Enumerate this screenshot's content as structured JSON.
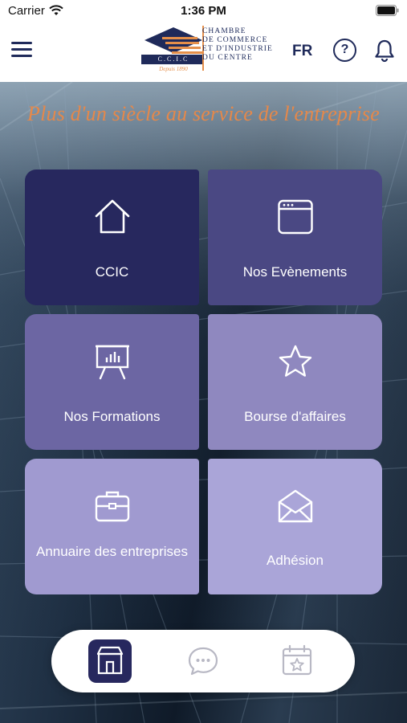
{
  "status_bar": {
    "carrier": "Carrier",
    "time": "1:36 PM"
  },
  "header": {
    "logo_lines": [
      "CHAMBRE",
      "DE COMMERCE",
      "ET D'INDUSTRIE",
      "DU CENTRE"
    ],
    "logo_initials": "C.C.I.C",
    "logo_motto": "Depuis 1890",
    "language": "FR",
    "help_symbol": "?",
    "icons": [
      "menu-icon",
      "help-icon",
      "bell-icon"
    ]
  },
  "tagline": "Plus d'un siècle au service de l'entreprise",
  "tiles": [
    {
      "label": "CCIC",
      "icon": "home-icon"
    },
    {
      "label": "Nos Evènements",
      "icon": "browser-window-icon"
    },
    {
      "label": "Nos Formations",
      "icon": "presentation-chart-icon"
    },
    {
      "label": "Bourse d'affaires",
      "icon": "star-icon"
    },
    {
      "label": "Annuaire des entreprises",
      "icon": "briefcase-icon"
    },
    {
      "label": "Adhésion",
      "icon": "envelope-icon"
    }
  ],
  "tabbar": {
    "tabs": [
      {
        "icon": "storefront-icon",
        "active": true
      },
      {
        "icon": "chat-bubble-icon",
        "active": false
      },
      {
        "icon": "calendar-star-icon",
        "active": false
      }
    ]
  },
  "colors": {
    "primary": "#27285e",
    "accent": "#e5884a",
    "tile_shades": [
      "#27285e",
      "#4a4883",
      "#6c66a3",
      "#8f88bf",
      "#a09ad0",
      "#aaa5d8"
    ]
  }
}
